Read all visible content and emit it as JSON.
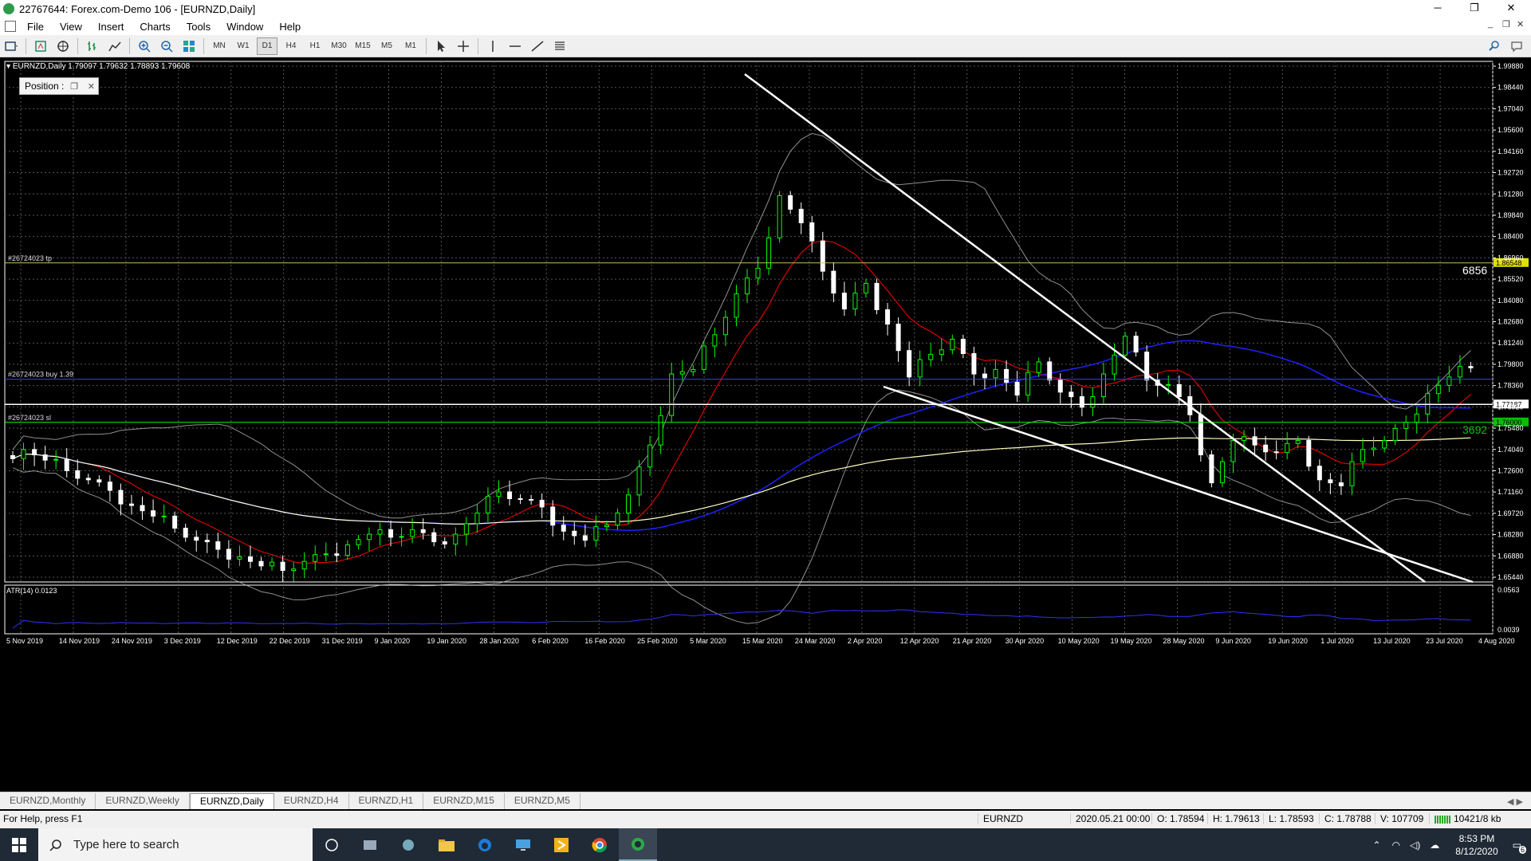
{
  "window": {
    "title": "22767644: Forex.com-Demo 106 - [EURNZD,Daily]",
    "minimize": "─",
    "restore": "❐",
    "close": "✕"
  },
  "menu": [
    "File",
    "View",
    "Insert",
    "Charts",
    "Tools",
    "Window",
    "Help"
  ],
  "toolbar": {
    "periods": [
      "MN",
      "W1",
      "D1",
      "H4",
      "H1",
      "M30",
      "M15",
      "M5",
      "M1"
    ],
    "active_period": "D1"
  },
  "chart": {
    "symbol_line": "EURNZD,Daily  1.79097 1.79632 1.78893 1.79608",
    "position_panel_label": "Position :",
    "tp_label": "#26724023 tp",
    "buy_label": "#26724023 buy 1.39",
    "sl_label": "#26724023 sl",
    "tp_price": "1.86548",
    "current_price": "1.77187",
    "sl_price": "1.76000",
    "tp_points": "6856",
    "sl_points": "3692",
    "atr_label": "ATR(14) 0.0123",
    "atr_top": "0.0563",
    "atr_bottom": "0.0039",
    "colors": {
      "bull": "#00ff00",
      "bear": "#ffffff",
      "ma_red": "#ff0000",
      "ma_blue": "#2020ff",
      "ma_yellow": "#ffffc0",
      "bands": "#cccccc",
      "levels": "#c0c060",
      "buyline": "#4040ff"
    }
  },
  "chart_data": {
    "type": "line",
    "title": "",
    "price_ticks": [
      "1.99880",
      "1.98440",
      "1.97040",
      "1.95600",
      "1.94160",
      "1.92720",
      "1.91280",
      "1.89840",
      "1.88400",
      "1.86960",
      "1.85520",
      "1.84080",
      "1.82680",
      "1.81240",
      "1.79800",
      "1.78360",
      "1.76920",
      "1.75480",
      "1.74040",
      "1.72600",
      "1.71160",
      "1.69720",
      "1.68280",
      "1.66880",
      "1.65440"
    ],
    "ylim": [
      1.6544,
      1.9988
    ],
    "date_ticks": [
      "5 Nov 2019",
      "14 Nov 2019",
      "24 Nov 2019",
      "3 Dec 2019",
      "12 Dec 2019",
      "22 Dec 2019",
      "31 Dec 2019",
      "9 Jan 2020",
      "19 Jan 2020",
      "28 Jan 2020",
      "6 Feb 2020",
      "16 Feb 2020",
      "25 Feb 2020",
      "5 Mar 2020",
      "15 Mar 2020",
      "24 Mar 2020",
      "2 Apr 2020",
      "12 Apr 2020",
      "21 Apr 2020",
      "30 Apr 2020",
      "10 May 2020",
      "19 May 2020",
      "28 May 2020",
      "9 Jun 2020",
      "19 Jun 2020",
      "1 Jul 2020",
      "13 Jul 2020",
      "23 Jul 2020",
      "4 Aug 2020"
    ],
    "series": [
      {
        "name": "EURNZD",
        "values": [
          1.742,
          1.735,
          1.728,
          1.722,
          1.715,
          1.705,
          1.698,
          1.69,
          1.682,
          1.676,
          1.671,
          1.665,
          1.662,
          1.668,
          1.673,
          1.679,
          1.686,
          1.684,
          1.689,
          1.681,
          1.686,
          1.7,
          1.714,
          1.709,
          1.704,
          1.688,
          1.682,
          1.692,
          1.712,
          1.745,
          1.792,
          1.795,
          1.818,
          1.845,
          1.862,
          1.91,
          1.892,
          1.86,
          1.835,
          1.852,
          1.825,
          1.79,
          1.805,
          1.815,
          1.792,
          1.795,
          1.778,
          1.8,
          1.78,
          1.77,
          1.792,
          1.817,
          1.788,
          1.785,
          1.765,
          1.72,
          1.748,
          1.745,
          1.74,
          1.748,
          1.722,
          1.718,
          1.742,
          1.748,
          1.76,
          1.779,
          1.79,
          1.796
        ]
      }
    ]
  },
  "tabs": [
    "EURNZD,Monthly",
    "EURNZD,Weekly",
    "EURNZD,Daily",
    "EURNZD,H4",
    "EURNZD,H1",
    "EURNZD,M15",
    "EURNZD,M5"
  ],
  "active_tab": "EURNZD,Daily",
  "tabs_nav": "◀ ▶",
  "status": {
    "help": "For Help, press F1",
    "symbol": "EURNZD",
    "datetime": "2020.05.21 00:00",
    "open": "O: 1.78594",
    "high": "H: 1.79613",
    "low": "L: 1.78593",
    "close": "C: 1.78788",
    "volume": "V: 107709",
    "traffic": "10421/8 kb"
  },
  "taskbar": {
    "search_placeholder": "Type here to search",
    "time": "8:53 PM",
    "date": "8/12/2020",
    "notifications": "6"
  }
}
